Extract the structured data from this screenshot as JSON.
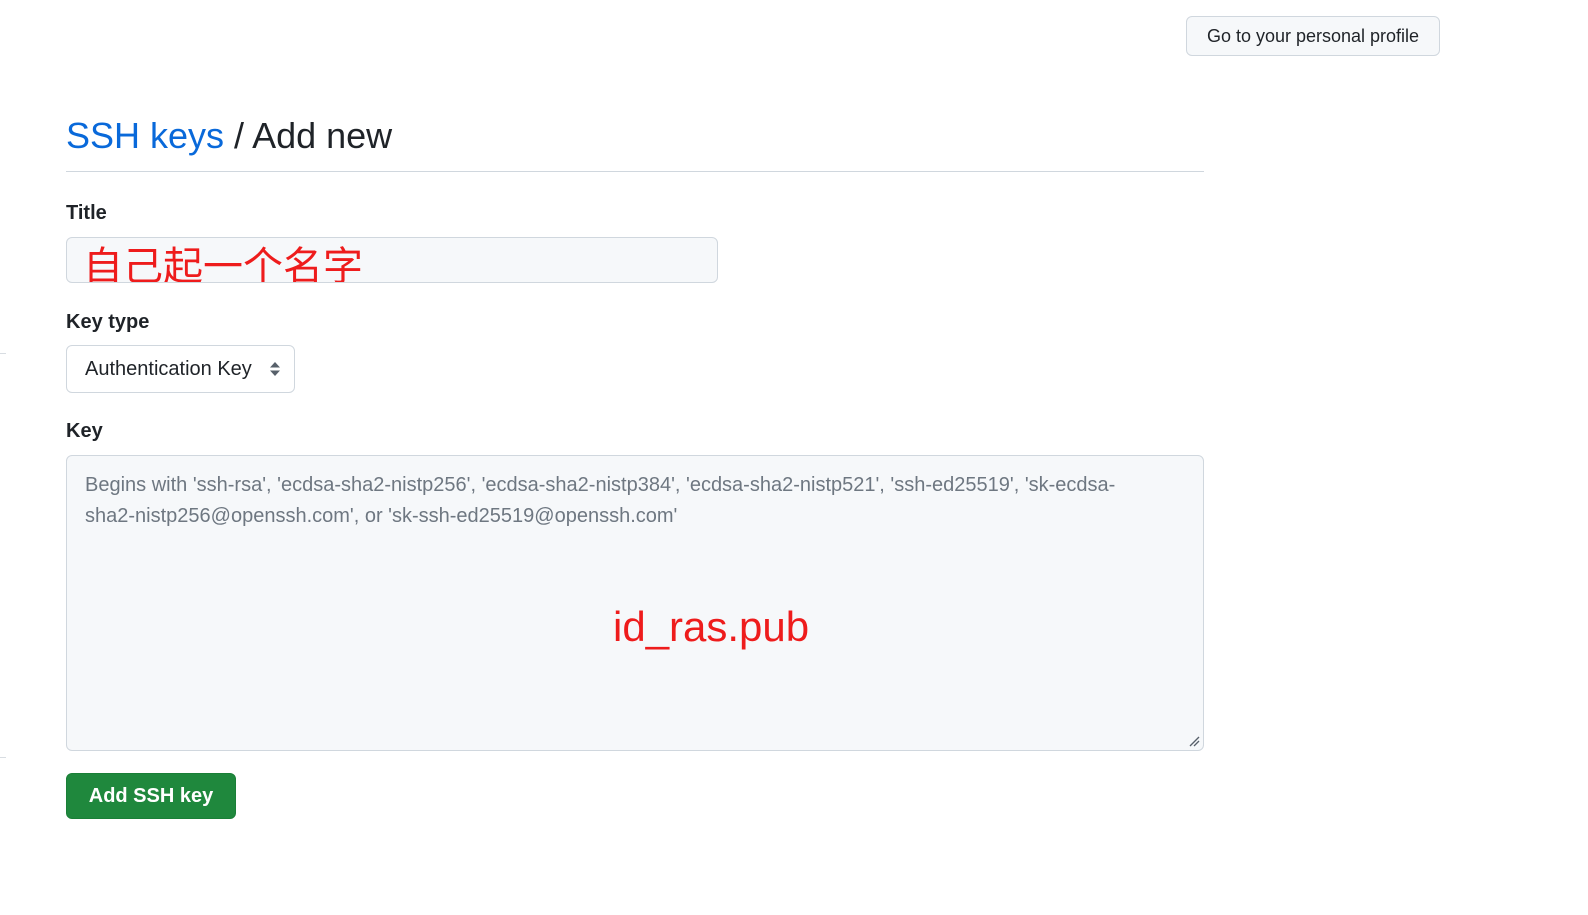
{
  "header": {
    "profile_button_label": "Go to your personal profile"
  },
  "page": {
    "breadcrumb_link": "SSH keys",
    "breadcrumb_separator": " / ",
    "breadcrumb_current": "Add new"
  },
  "form": {
    "title_label": "Title",
    "title_annotation": "自己起一个名字",
    "key_type_label": "Key type",
    "key_type_selected": "Authentication Key",
    "key_label": "Key",
    "key_placeholder": "Begins with 'ssh-rsa', 'ecdsa-sha2-nistp256', 'ecdsa-sha2-nistp384', 'ecdsa-sha2-nistp521', 'ssh-ed25519', 'sk-ecdsa-sha2-nistp256@openssh.com', or 'sk-ssh-ed25519@openssh.com'",
    "key_annotation": "id_ras.pub",
    "submit_label": "Add SSH key"
  },
  "colors": {
    "link": "#0969da",
    "annotation": "#ee1c1c",
    "primary_button": "#1f883d",
    "input_bg": "#f6f8fa",
    "border": "#d0d7de"
  },
  "icons": {
    "select_chevron": "select-up-down-icon",
    "resize": "resize-grip-icon"
  }
}
